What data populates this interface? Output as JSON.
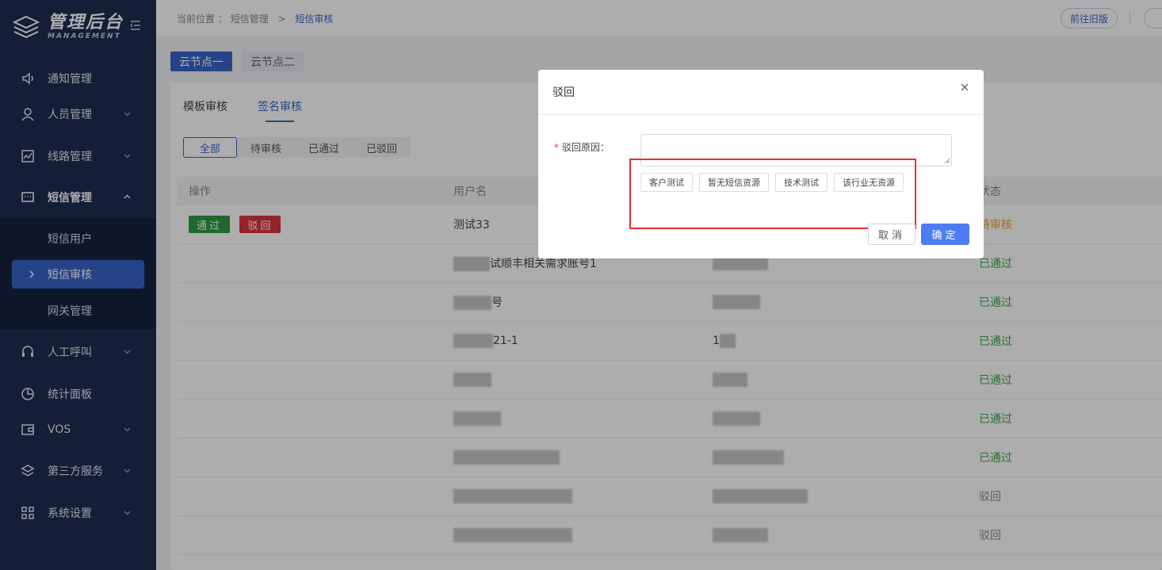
{
  "app": {
    "title": "管理后台",
    "subtitle": "MANAGEMENT"
  },
  "sidebar": {
    "items": [
      {
        "label": "通知管理",
        "icon": "speaker-icon"
      },
      {
        "label": "人员管理",
        "icon": "user-icon"
      },
      {
        "label": "线路管理",
        "icon": "line-chart-icon"
      },
      {
        "label": "短信管理",
        "icon": "message-icon"
      },
      {
        "label": "人工呼叫",
        "icon": "headset-icon"
      },
      {
        "label": "统计面板",
        "icon": "pie-icon"
      },
      {
        "label": "VOS",
        "icon": "wallet-icon"
      },
      {
        "label": "第三方服务",
        "icon": "layers-icon"
      },
      {
        "label": "系统设置",
        "icon": "grid-icon"
      }
    ],
    "sms_sub": [
      "短信用户",
      "短信审核",
      "网关管理"
    ]
  },
  "breadcrumb": {
    "prefix": "当前位置",
    "colon": "：",
    "level1": "短信管理",
    "separator": ">",
    "level2": "短信审核"
  },
  "topbar": {
    "old_version_label": "前往旧版"
  },
  "node_tabs": [
    "云节点一",
    "云节点二"
  ],
  "sub_tabs": [
    "模板审核",
    "签名审核"
  ],
  "filters": [
    "全部",
    "待审核",
    "已通过",
    "已驳回"
  ],
  "table": {
    "headers": {
      "op": "操作",
      "user": "用户名",
      "status": "状态"
    },
    "op_pass": "通过",
    "op_reject": "驳回",
    "rows": [
      {
        "user": "测试33",
        "mid": "",
        "status": "待审核",
        "type": "pending"
      },
      {
        "user": "试顺丰相关需求账号1",
        "mid": "",
        "status": "已通过",
        "type": "pass"
      },
      {
        "user": "号",
        "mid": "",
        "status": "已通过",
        "type": "pass"
      },
      {
        "user": "21-1",
        "mid": "1",
        "status": "已通过",
        "type": "pass"
      },
      {
        "user": "",
        "mid": "",
        "status": "已通过",
        "type": "pass"
      },
      {
        "user": "",
        "mid": "",
        "status": "已通过",
        "type": "pass"
      },
      {
        "user": "",
        "mid": "",
        "status": "已通过",
        "type": "pass"
      },
      {
        "user": "",
        "mid": "",
        "status": "驳回",
        "type": "reject"
      },
      {
        "user": "",
        "mid": "",
        "status": "驳回",
        "type": "reject"
      }
    ]
  },
  "modal": {
    "title": "驳回",
    "field_label": "驳回原因：",
    "required_mark": "*",
    "reason_value": "",
    "quick_reasons": [
      "客户测试",
      "暂无短信资源",
      "技术测试",
      "该行业无资源"
    ],
    "cancel_label": "取消",
    "ok_label": "确定"
  },
  "colors": {
    "sidebar_bg": "#1e2d52",
    "accent": "#3a63c9",
    "primary_button": "#4f7cf0",
    "pass": "#3aa64a",
    "pending": "#e6a23c",
    "highlight": "#e8302f"
  }
}
